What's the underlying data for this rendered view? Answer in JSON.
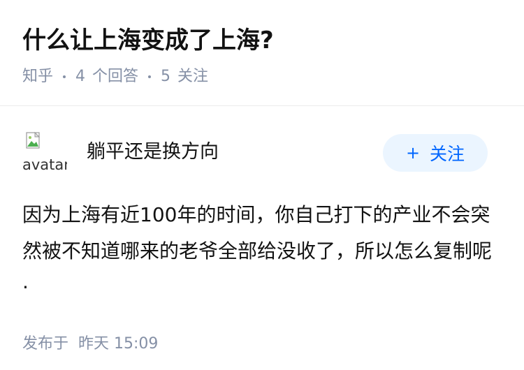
{
  "question": {
    "title": "什么让上海变成了上海?",
    "source": "知乎",
    "answer_count": "4",
    "answer_label": "个回答",
    "follow_count": "5",
    "follow_label": "关注"
  },
  "answer": {
    "author": {
      "name": "躺平还是换方向",
      "avatar_alt": "avatar"
    },
    "follow_button": {
      "icon": "plus-icon",
      "label": "关注"
    },
    "content": "因为上海有近100年的时间，你自己打下的产业不会突然被不知道哪来的老爷全部给没收了，所以怎么复制呢·",
    "time_prefix": "发布于",
    "time_value": "昨天 15:09"
  },
  "colors": {
    "text": "#121212",
    "meta": "#8590a6",
    "accent": "#0066ff",
    "button_bg": "#ebf5ff",
    "divider": "#ebebeb"
  }
}
